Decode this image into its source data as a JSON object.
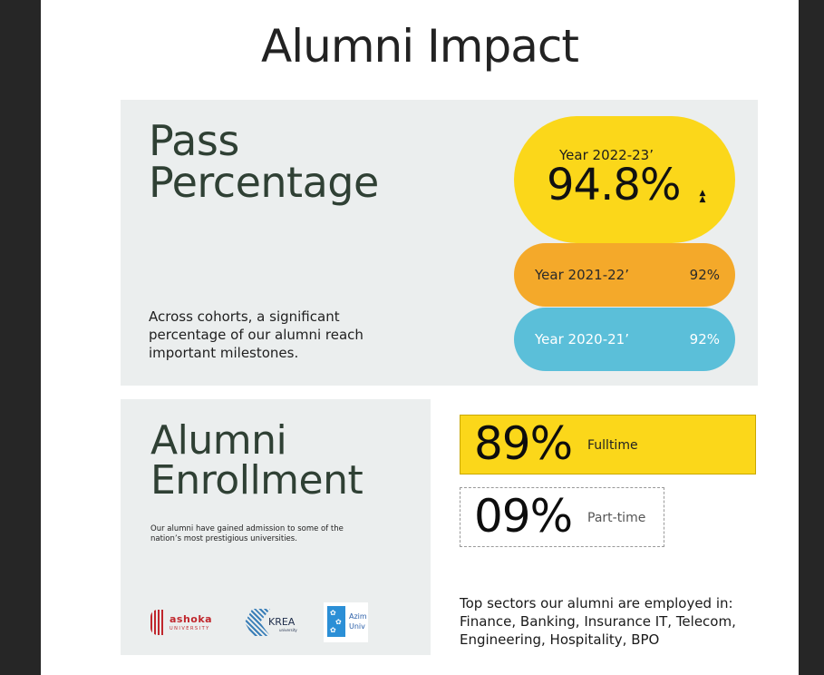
{
  "page": {
    "title": "Alumni Impact"
  },
  "pass": {
    "title_line1": "Pass",
    "title_line2": "Percentage",
    "description": "Across cohorts, a significant percentage of our alumni reach important milestones.",
    "highlight": {
      "year": "Year 2022-23’",
      "value": "94.8%"
    },
    "rows": [
      {
        "year": "Year 2021-22’",
        "value": "92%",
        "color": "#f4a92a"
      },
      {
        "year": "Year 2020-21’",
        "value": "92%",
        "color": "#5bbfd9"
      }
    ],
    "highlight_color": "#fbd71a"
  },
  "enrollment": {
    "title_line1": "Alumni",
    "title_line2": "Enrollment",
    "description": "Our alumni have gained admission to some of the nation’s most prestigious universities.",
    "logos": {
      "ashoka": {
        "name": "ashoka",
        "sub": "UNIVERSITY"
      },
      "krea": {
        "name": "KREA",
        "sub": "university"
      },
      "azim": {
        "name_line1": "Azim",
        "name_line2": "Univ"
      }
    }
  },
  "stats": {
    "fulltime": {
      "value": "89%",
      "label": "Fulltime"
    },
    "parttime": {
      "value": "09%",
      "label": "Part-time"
    }
  },
  "sectors": {
    "intro": "Top sectors our alumni are employed in:",
    "list": "Finance, Banking, Insurance IT, Telecom, Engineering, Hospitality, BPO"
  }
}
